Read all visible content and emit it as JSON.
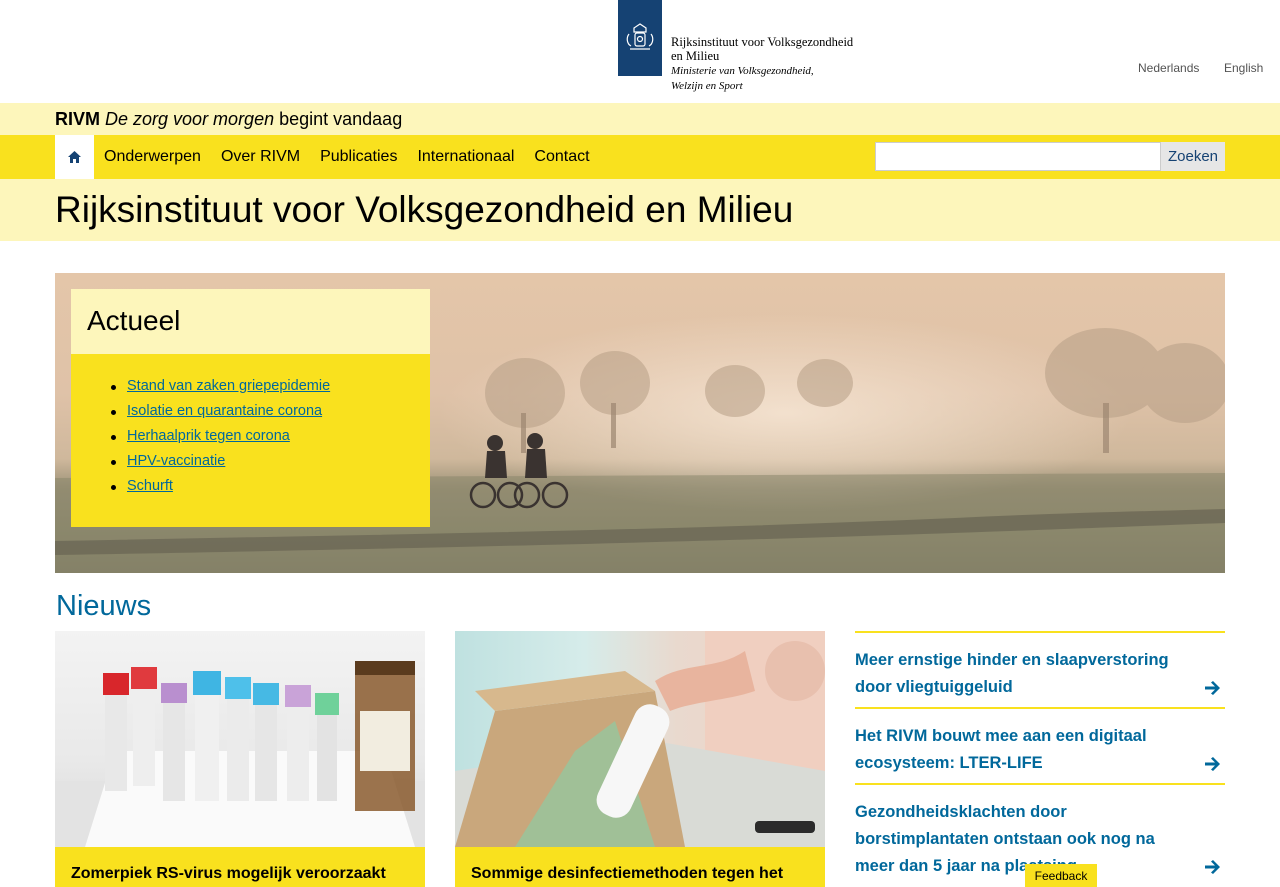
{
  "header": {
    "org_line1": "Rijksinstituut voor Volksgezondheid",
    "org_line2": "en Milieu",
    "ministry_line1": "Ministerie van Volksgezondheid,",
    "ministry_line2": "Welzijn en Sport",
    "languages": [
      "Nederlands",
      "English"
    ]
  },
  "slogan": {
    "brand": "RIVM",
    "italic": "De zorg voor morgen",
    "rest": " begint vandaag"
  },
  "nav": {
    "items": [
      "Onderwerpen",
      "Over RIVM",
      "Publicaties",
      "Internationaal",
      "Contact"
    ],
    "search_value": "",
    "search_button": "Zoeken"
  },
  "page_title": "Rijksinstituut voor Volksgezondheid en Milieu",
  "actueel": {
    "title": "Actueel",
    "links": [
      "Stand van zaken griepepidemie",
      "Isolatie en quarantaine corona",
      "Herhaalprik tegen corona",
      "HPV-vaccinatie",
      "Schurft"
    ]
  },
  "news": {
    "heading": "Nieuws",
    "cards": [
      "Zomerpiek RS-virus mogelijk veroorzaakt",
      "Sommige desinfectiemethoden tegen het"
    ],
    "side_items": [
      "Meer ernstige hinder en slaapverstoring door vliegtuiggeluid",
      "Het RIVM bouwt mee aan een digitaal ecosysteem: LTER-LIFE",
      "Gezondheidsklachten door borstimplantaten ontstaan ook nog na meer dan 5 jaar na plaatsing"
    ]
  },
  "feedback": "Feedback",
  "colors": {
    "brand_blue": "#154273",
    "yellow": "#f9e11e",
    "light_yellow": "#fdf6bb",
    "link_blue": "#01689b"
  }
}
